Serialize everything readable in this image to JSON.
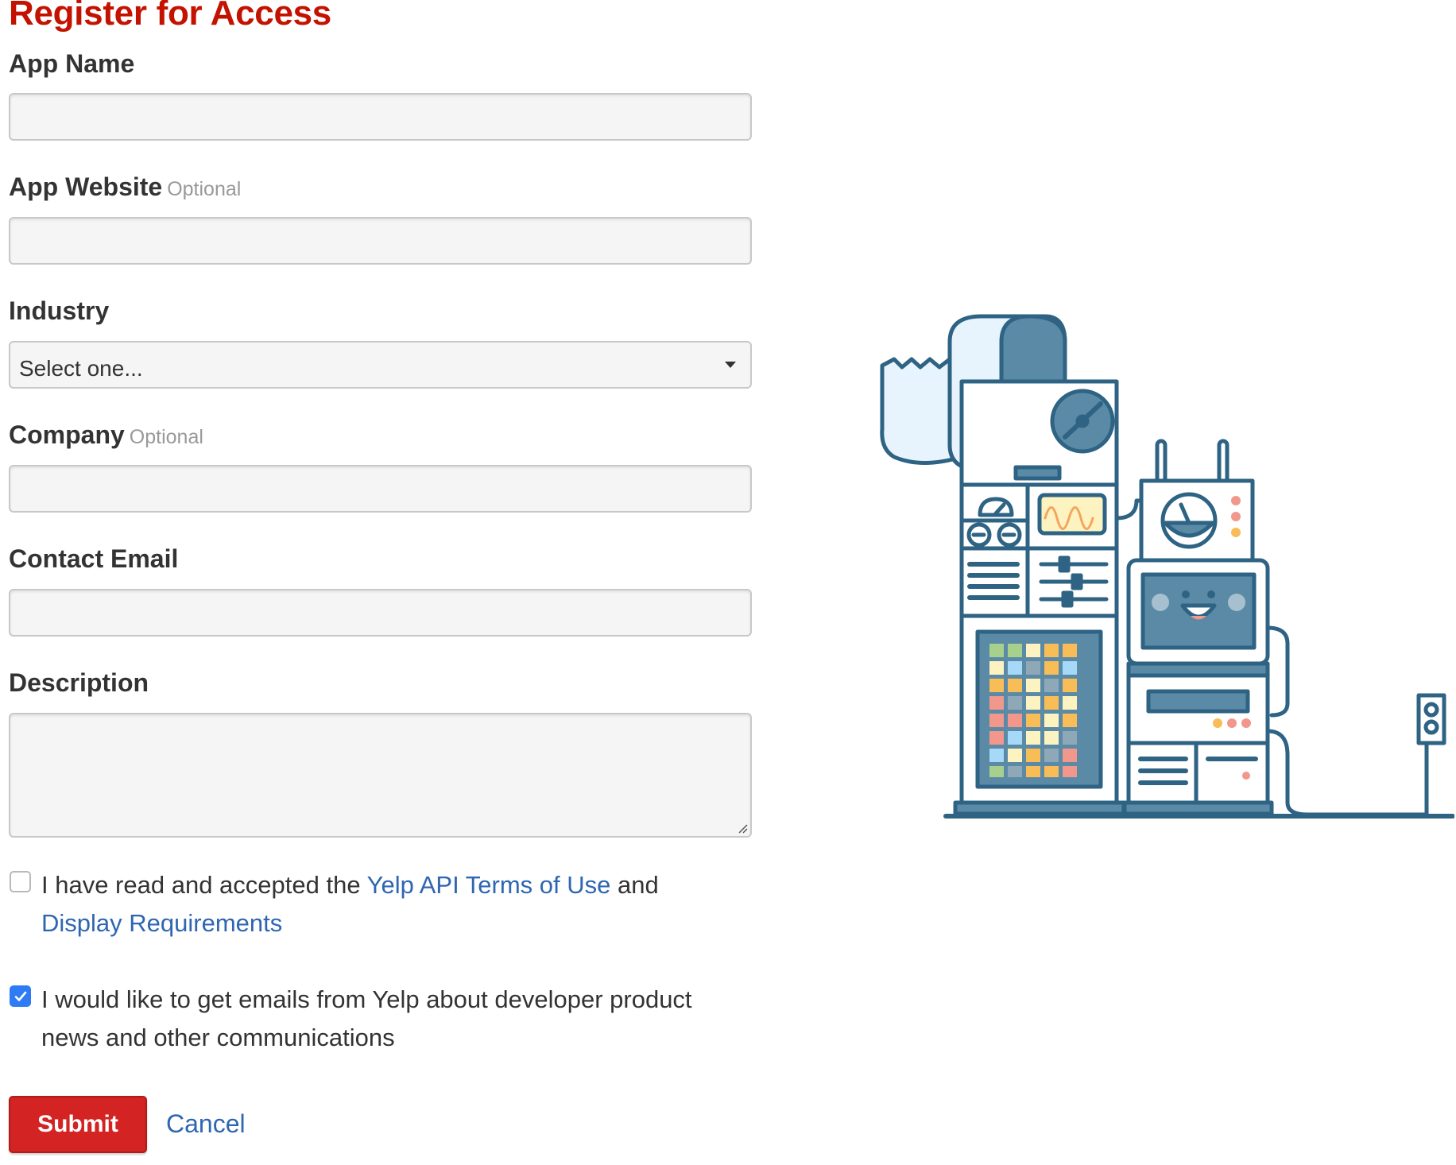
{
  "page": {
    "title": "Register for Access"
  },
  "form": {
    "app_name": {
      "label": "App Name",
      "value": ""
    },
    "app_website": {
      "label": "App Website",
      "optional": "Optional",
      "value": ""
    },
    "industry": {
      "label": "Industry",
      "selected": "Select one..."
    },
    "company": {
      "label": "Company",
      "optional": "Optional",
      "value": ""
    },
    "contact_email": {
      "label": "Contact Email",
      "value": ""
    },
    "description": {
      "label": "Description",
      "value": ""
    },
    "terms": {
      "checked": false,
      "text_before": "I have read and accepted the ",
      "terms_link": "Yelp API Terms of Use",
      "text_middle": " and",
      "display_link": "Display Requirements"
    },
    "emails_opt_in": {
      "checked": true,
      "text": "I would like to get emails from Yelp about developer product news and other communications"
    },
    "submit_label": "Submit",
    "cancel_label": "Cancel"
  },
  "colors": {
    "title": "#c41200",
    "link": "#2f66b2",
    "submit_bg": "#d32323",
    "checkbox_checked": "#2f7bf5",
    "illustration_stroke": "#2e6384",
    "illustration_fill": "#5b8aa6"
  },
  "illustration": {
    "icon": "robot-machine-illustration"
  }
}
